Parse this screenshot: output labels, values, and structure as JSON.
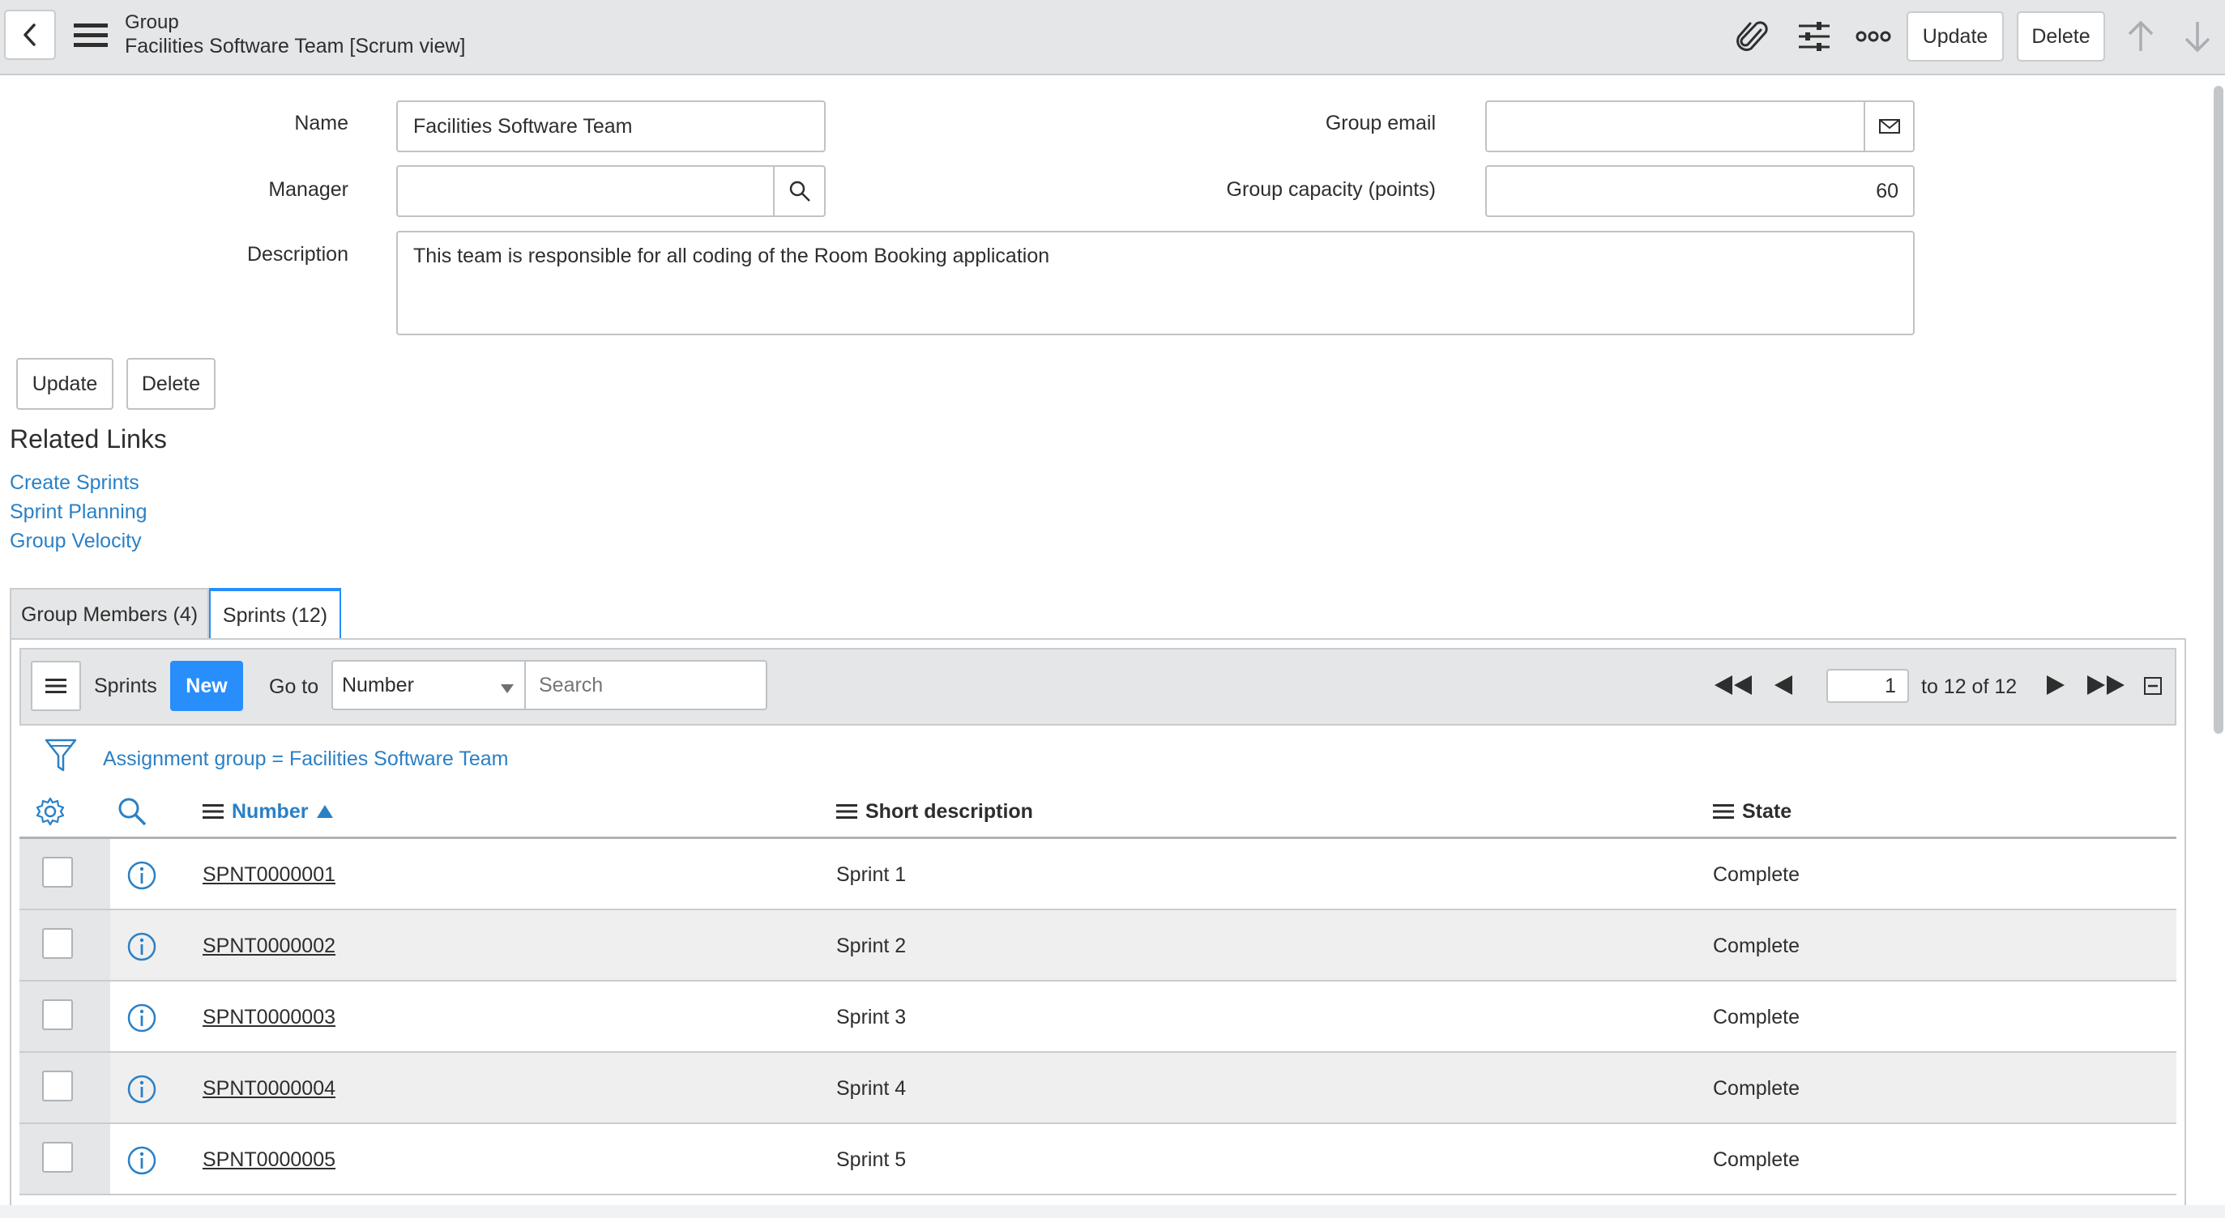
{
  "header": {
    "title": "Group",
    "subtitle": "Facilities Software Team [Scrum view]",
    "update_label": "Update",
    "delete_label": "Delete"
  },
  "form": {
    "name_label": "Name",
    "name_value": "Facilities Software Team",
    "manager_label": "Manager",
    "manager_value": "",
    "description_label": "Description",
    "description_value": "This team is responsible for all coding of the Room Booking application",
    "group_email_label": "Group email",
    "group_email_value": "",
    "capacity_label": "Group capacity (points)",
    "capacity_value": "60",
    "update_label": "Update",
    "delete_label": "Delete"
  },
  "related_links": {
    "title": "Related Links",
    "items": [
      "Create Sprints",
      "Sprint Planning",
      "Group Velocity"
    ]
  },
  "tabs": [
    {
      "label": "Group Members (4)",
      "active": false
    },
    {
      "label": "Sprints (12)",
      "active": true
    }
  ],
  "list": {
    "title": "Sprints",
    "new_label": "New",
    "goto_label": "Go to",
    "goto_select": "Number",
    "search_placeholder": "Search",
    "page_value": "1",
    "page_range": "to 12 of 12",
    "filter_text": "Assignment group = Facilities Software Team",
    "columns": [
      "Number",
      "Short description",
      "State"
    ],
    "rows": [
      {
        "number": "SPNT0000001",
        "description": "Sprint 1",
        "state": "Complete"
      },
      {
        "number": "SPNT0000002",
        "description": "Sprint 2",
        "state": "Complete"
      },
      {
        "number": "SPNT0000003",
        "description": "Sprint 3",
        "state": "Complete"
      },
      {
        "number": "SPNT0000004",
        "description": "Sprint 4",
        "state": "Complete"
      },
      {
        "number": "SPNT0000005",
        "description": "Sprint 5",
        "state": "Complete"
      }
    ]
  },
  "colors": {
    "accent": "#2b80c5",
    "header_bg": "#e4e6e7",
    "new_button": "#278efc"
  },
  "icons": [
    "back-icon",
    "menu-icon",
    "paperclip-icon",
    "settings-sliders-icon",
    "more-icon",
    "arrow-up-icon",
    "arrow-down-icon",
    "search-icon",
    "email-icon",
    "filter-icon",
    "gear-icon",
    "info-icon",
    "first-page-icon",
    "prev-page-icon",
    "next-page-icon",
    "last-page-icon",
    "collapse-icon"
  ]
}
